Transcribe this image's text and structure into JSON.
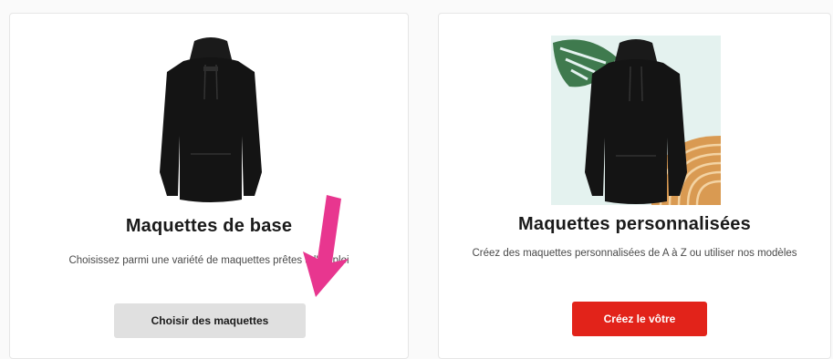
{
  "cards": [
    {
      "title": "Maquettes de base",
      "description": "Choisissez parmi une variété de maquettes prêtes à l'emploi",
      "button_label": "Choisir des maquettes",
      "image": "black-hoodie"
    },
    {
      "title": "Maquettes personnalisées",
      "description": "Créez des maquettes personnalisées de A à Z ou utiliser nos modèles",
      "button_label": "Créez le vôtre",
      "image": "black-hoodie-with-plant-background"
    }
  ],
  "colors": {
    "primary_button": "#e2231a",
    "secondary_button": "#e0e0e0",
    "annotation_arrow": "#e8368f",
    "hoodie": "#141414"
  }
}
